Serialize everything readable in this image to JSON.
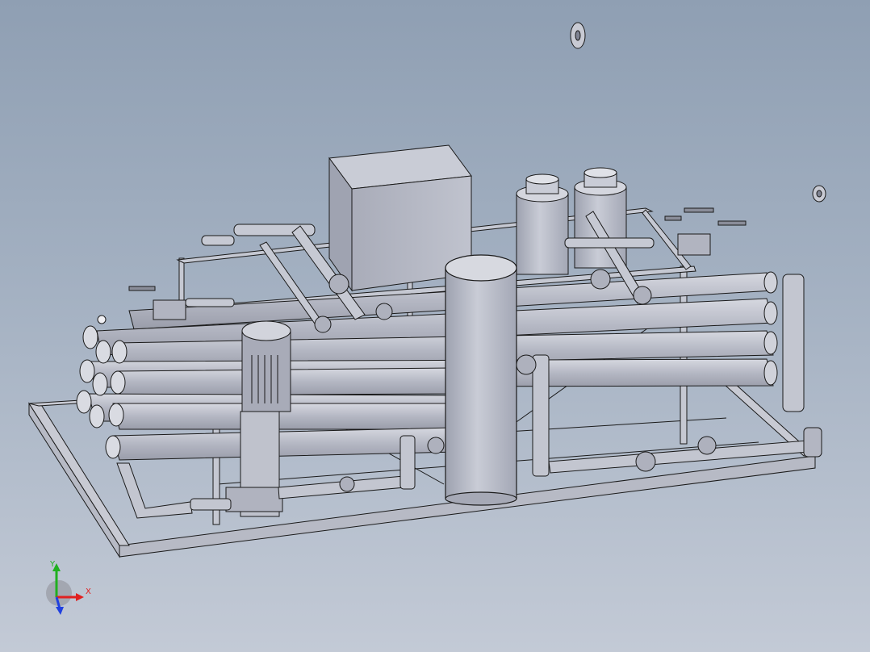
{
  "viewport": {
    "background_top": "#8f9fb3",
    "background_bottom": "#c3cad6"
  },
  "model": {
    "description_icon": "ro-skid-3d-model",
    "body_color": "#b9bcc7",
    "edge_color": "#1a1a1a"
  },
  "triad": {
    "x_label": "X",
    "y_label": "Y",
    "x_color": "#e02020",
    "y_color": "#20b020",
    "z_color": "#2040e0"
  }
}
